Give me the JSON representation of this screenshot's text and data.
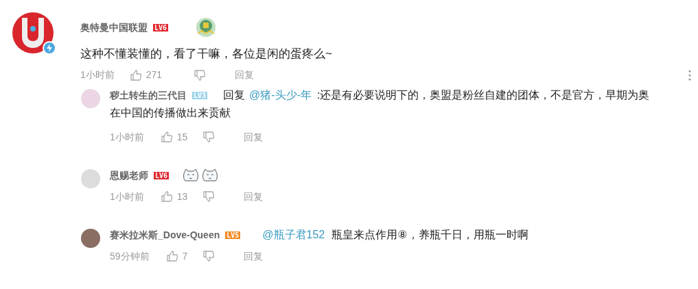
{
  "comment": {
    "author": "奥特曼中国联盟",
    "level": {
      "text": "LV6",
      "color": "#e0282e"
    },
    "text": "这种不懂装懂的，看了干嘛，各位是闲的蛋疼么~",
    "time": "1小时前",
    "likes": "271",
    "reply_label": "回复"
  },
  "replies": [
    {
      "author": "秽土转生的三代目",
      "level": {
        "text": "LV3",
        "color": "#9ed4ea"
      },
      "kind": "text",
      "prefix": "回复",
      "mention": "@猪-头少-年",
      "lines": [
        ":还是有必要说明下的，奥盟是粉丝自建的团体，不是官方，早期为奥",
        "在中国的传播做出来贡献"
      ],
      "time": "1小时前",
      "likes": "15",
      "reply_label": "回复"
    },
    {
      "author": "恩赐老师",
      "level": {
        "text": "LV6",
        "color": "#e0282e"
      },
      "kind": "emoji",
      "emojis": [
        {
          "kind": "smirk"
        },
        {
          "kind": "smirk"
        }
      ],
      "time": "1小时前",
      "likes": "13",
      "reply_label": "回复"
    },
    {
      "author": "赛米拉米斯_Dove-Queen",
      "level": {
        "text": "LV5",
        "color": "#f08c26"
      },
      "kind": "text",
      "mention": "@瓶子君152",
      "lines": [
        "瓶皇来点作用⑧，养瓶千日，用瓶一时啊"
      ],
      "time": "59分钟前",
      "likes": "7",
      "reply_label": "回复"
    }
  ]
}
